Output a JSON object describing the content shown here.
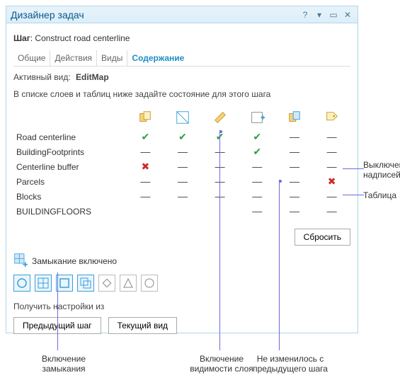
{
  "window": {
    "title": "Дизайнер задач"
  },
  "step": {
    "prefix": "Шаг",
    "name": "Construct road centerline"
  },
  "tabs": {
    "general": "Общие",
    "actions": "Действия",
    "views": "Виды",
    "contents": "Содержание"
  },
  "active_view": {
    "label": "Активный вид:",
    "value": "EditMap"
  },
  "instruction": "В списке слоев и таблиц ниже задайте состояние для этого шага",
  "columns": {
    "snapping": "snapping",
    "selectable": "selectable",
    "editable": "editable",
    "layer_vis": "layer_vis",
    "symbology": "symbology",
    "labels": "labels"
  },
  "rows": [
    {
      "name": "Road centerline",
      "cells": [
        "check",
        "check",
        "check",
        "check",
        "dash",
        "dash"
      ]
    },
    {
      "name": "BuildingFootprints",
      "cells": [
        "dash",
        "dash",
        "dash",
        "check",
        "dash",
        "dash"
      ]
    },
    {
      "name": "Centerline buffer",
      "cells": [
        "cross",
        "dash",
        "dash",
        "dash",
        "dash",
        "dash"
      ]
    },
    {
      "name": "Parcels",
      "cells": [
        "dash",
        "dash",
        "dash",
        "dash",
        "dash",
        "cross"
      ]
    },
    {
      "name": "Blocks",
      "cells": [
        "dash",
        "dash",
        "dash",
        "dash",
        "dash",
        "dash"
      ]
    },
    {
      "name": "BUILDINGFLOORS",
      "cells": [
        "",
        "",
        "",
        "dash",
        "dash",
        "dash"
      ]
    }
  ],
  "buttons": {
    "reset": "Сбросить",
    "prev_step": "Предыдущий шаг",
    "current_view": "Текущий вид"
  },
  "snapping": {
    "label": "Замыкание включено"
  },
  "get_settings": "Получить настройки из",
  "annotations": {
    "labels_off_1": "Выключени",
    "labels_off_2": "надписей",
    "table": "Таблица",
    "snap_on_1": "Включение",
    "snap_on_2": "замыкания",
    "vis_on_1": "Включение",
    "vis_on_2": "видимости слоя",
    "unchanged_1": "Не изменилось с",
    "unchanged_2": "предыдущего шага"
  }
}
